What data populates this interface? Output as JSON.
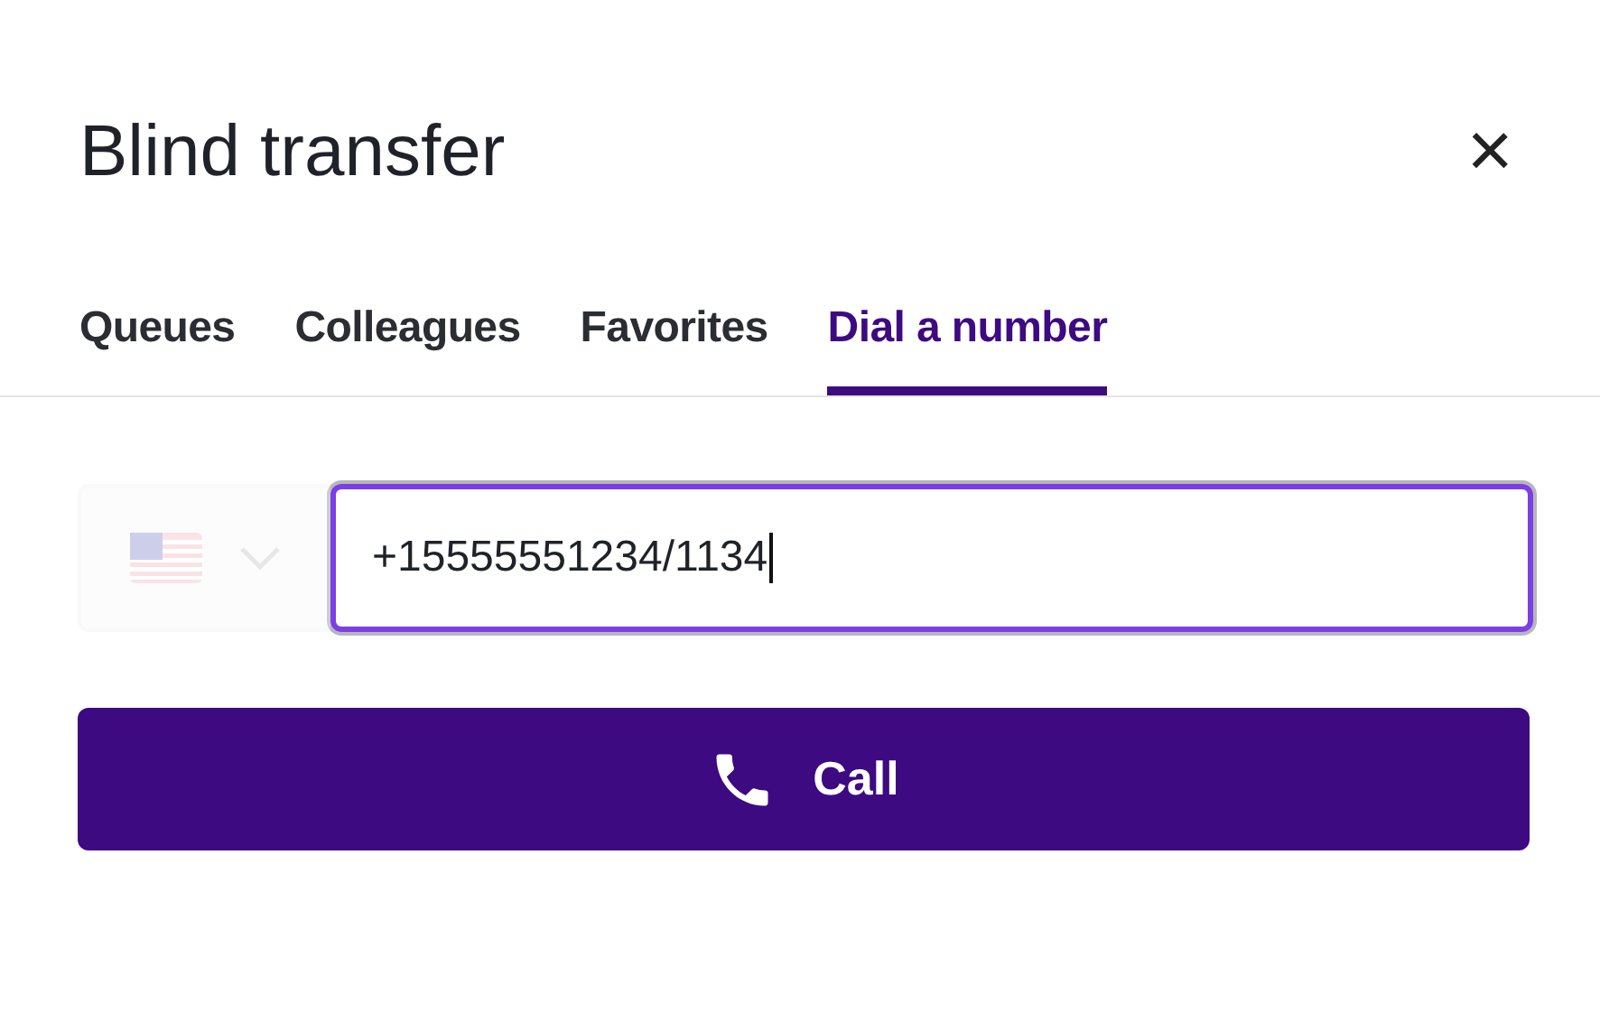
{
  "dialog": {
    "title": "Blind transfer",
    "close": "×"
  },
  "tabs": [
    {
      "label": "Queues",
      "selected": false
    },
    {
      "label": "Colleagues",
      "selected": false
    },
    {
      "label": "Favorites",
      "selected": false
    },
    {
      "label": "Dial a number",
      "selected": true
    }
  ],
  "country_select": {
    "disabled": true
  },
  "phone_field": {
    "value": "+15555551234/1134",
    "focused": true
  },
  "call_button": {
    "label": "Call"
  }
}
